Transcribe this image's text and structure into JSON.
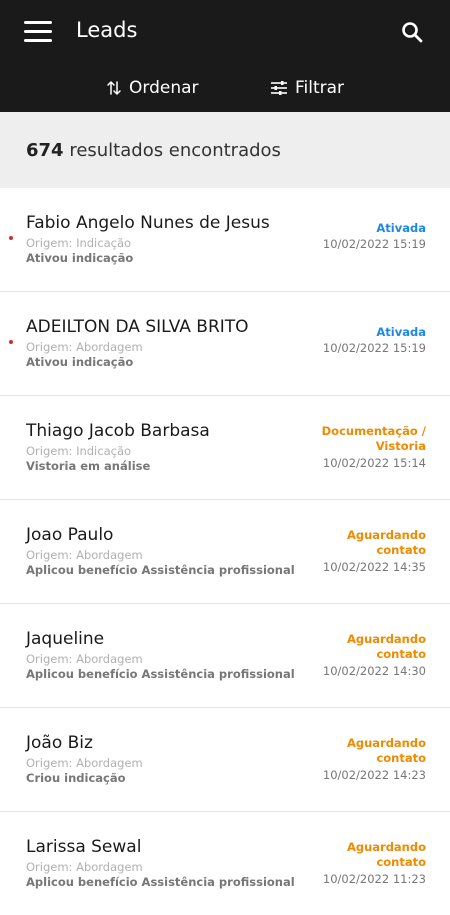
{
  "header": {
    "title": "Leads",
    "sort_label": "Ordenar",
    "filter_label": "Filtrar"
  },
  "summary": {
    "count": "674",
    "text": "resultados encontrados"
  },
  "leads": [
    {
      "name": "Fabio Angelo Nunes de Jesus",
      "origin": "Origem: Indicação",
      "action": "Ativou indicação",
      "status": "Ativada",
      "date": "10/02/2022 15:19",
      "unread": true
    },
    {
      "name": "ADEILTON DA SILVA BRITO",
      "origin": "Origem: Abordagem",
      "action": "Ativou indicação",
      "status": "Ativada",
      "date": "10/02/2022 15:19",
      "unread": true
    },
    {
      "name": "Thiago Jacob Barbasa",
      "origin": "Origem: Indicação",
      "action": "Vistoria em análise",
      "status": "Documentação / Vistoria",
      "date": "10/02/2022 15:14",
      "unread": false
    },
    {
      "name": "Joao Paulo",
      "origin": "Origem: Abordagem",
      "action": "Aplicou benefício Assistência profissional",
      "status": "Aguardando contato",
      "date": "10/02/2022 14:35",
      "unread": false
    },
    {
      "name": "Jaqueline",
      "origin": "Origem: Abordagem",
      "action": "Aplicou benefício Assistência profissional",
      "status": "Aguardando contato",
      "date": "10/02/2022 14:30",
      "unread": false
    },
    {
      "name": "João Biz",
      "origin": "Origem: Abordagem",
      "action": "Criou indicação",
      "status": "Aguardando contato",
      "date": "10/02/2022 14:23",
      "unread": false
    },
    {
      "name": "Larissa Sewal",
      "origin": "Origem: Abordagem",
      "action": "Aplicou benefício Assistência profissional",
      "status": "Aguardando contato",
      "date": "10/02/2022 11:23",
      "unread": false
    }
  ],
  "colors": {
    "header_bg": "#1a1a1a",
    "status_active": "#1e88e5",
    "status_pending": "#f08a00",
    "unread_dot": "#d32f2f"
  },
  "icons": [
    "menu-icon",
    "search-icon",
    "sort-icon",
    "filter-icon"
  ]
}
